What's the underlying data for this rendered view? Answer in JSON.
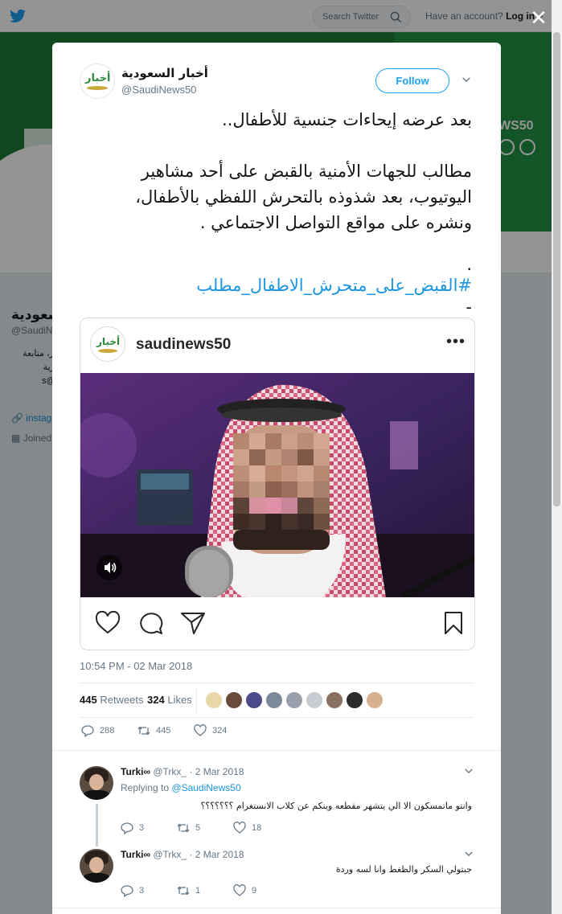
{
  "topbar": {
    "search_placeholder": "Search Twitter",
    "account_text": "Have an account?",
    "login_label": "Log in"
  },
  "banner": {
    "news_text": "WS50"
  },
  "profile": {
    "name_fragment": "سعودية",
    "handle_fragment": "@SaudiN",
    "bio_lines": [
      "يتر، متابعة",
      "رية .",
      "s@"
    ],
    "link_fragment": "instag",
    "joined_fragment": "Joined"
  },
  "tweet": {
    "author_name": "أخبار السعودية",
    "author_handle": "@SaudiNews50",
    "avatar_text": "أخبار",
    "follow_label": "Follow",
    "text_line1": "بعد عرضه إيحاءات جنسية للأطفال..",
    "text_line2": "مطالب للجهات الأمنية بالقبض على أحد مشاهير",
    "text_line3": "اليوتيوب، بعد شذوذه بالتحرش اللفظي بالأطفال،",
    "text_line4": "ونشره على مواقع التواصل الاجتماعي .",
    "text_dot": ".",
    "hashtag": "#القبض_على_متحرش_الاطفال_مطلب",
    "text_dash": "-",
    "timestamp": "10:54 PM - 02 Mar 2018",
    "retweets_count": "445",
    "retweets_label": "Retweets",
    "likes_count": "324",
    "likes_label": "Likes",
    "reply_count": "288",
    "retweet_action_count": "445",
    "like_action_count": "324"
  },
  "instagram": {
    "username": "saudinews50",
    "avatar_text": "أخبار",
    "more_label": "•••"
  },
  "replies": [
    {
      "name": "Turki∞",
      "handle": "@Trkx_",
      "date": "· 2 Mar 2018",
      "replying_prefix": "Replying to",
      "replying_to": "@SaudiNews50",
      "text": "وانتو ماتمسكون الا الي يتشهر مقطعه وينكم عن كلاب الانستغرام ؟؟؟؟؟؟؟",
      "replies": "3",
      "retweets": "5",
      "likes": "18"
    },
    {
      "name": "Turki∞",
      "handle": "@Trkx_",
      "date": "· 2 Mar 2018",
      "text": "جبتولي السكر والظغط وانا لسه  وردة",
      "replies": "3",
      "retweets": "1",
      "likes": "9"
    }
  ],
  "colors": {
    "twitter_blue": "#1da1f2",
    "link_blue": "#1b95e0",
    "banner_green": "#1c7a34",
    "muted_text": "#657786"
  },
  "icons": [
    "twitter-bird-icon",
    "search-icon",
    "close-icon",
    "caret-down-icon",
    "heart-icon",
    "comment-icon",
    "share-icon",
    "bookmark-icon",
    "reply-icon",
    "retweet-icon",
    "like-icon",
    "sound-icon",
    "more-icon"
  ]
}
